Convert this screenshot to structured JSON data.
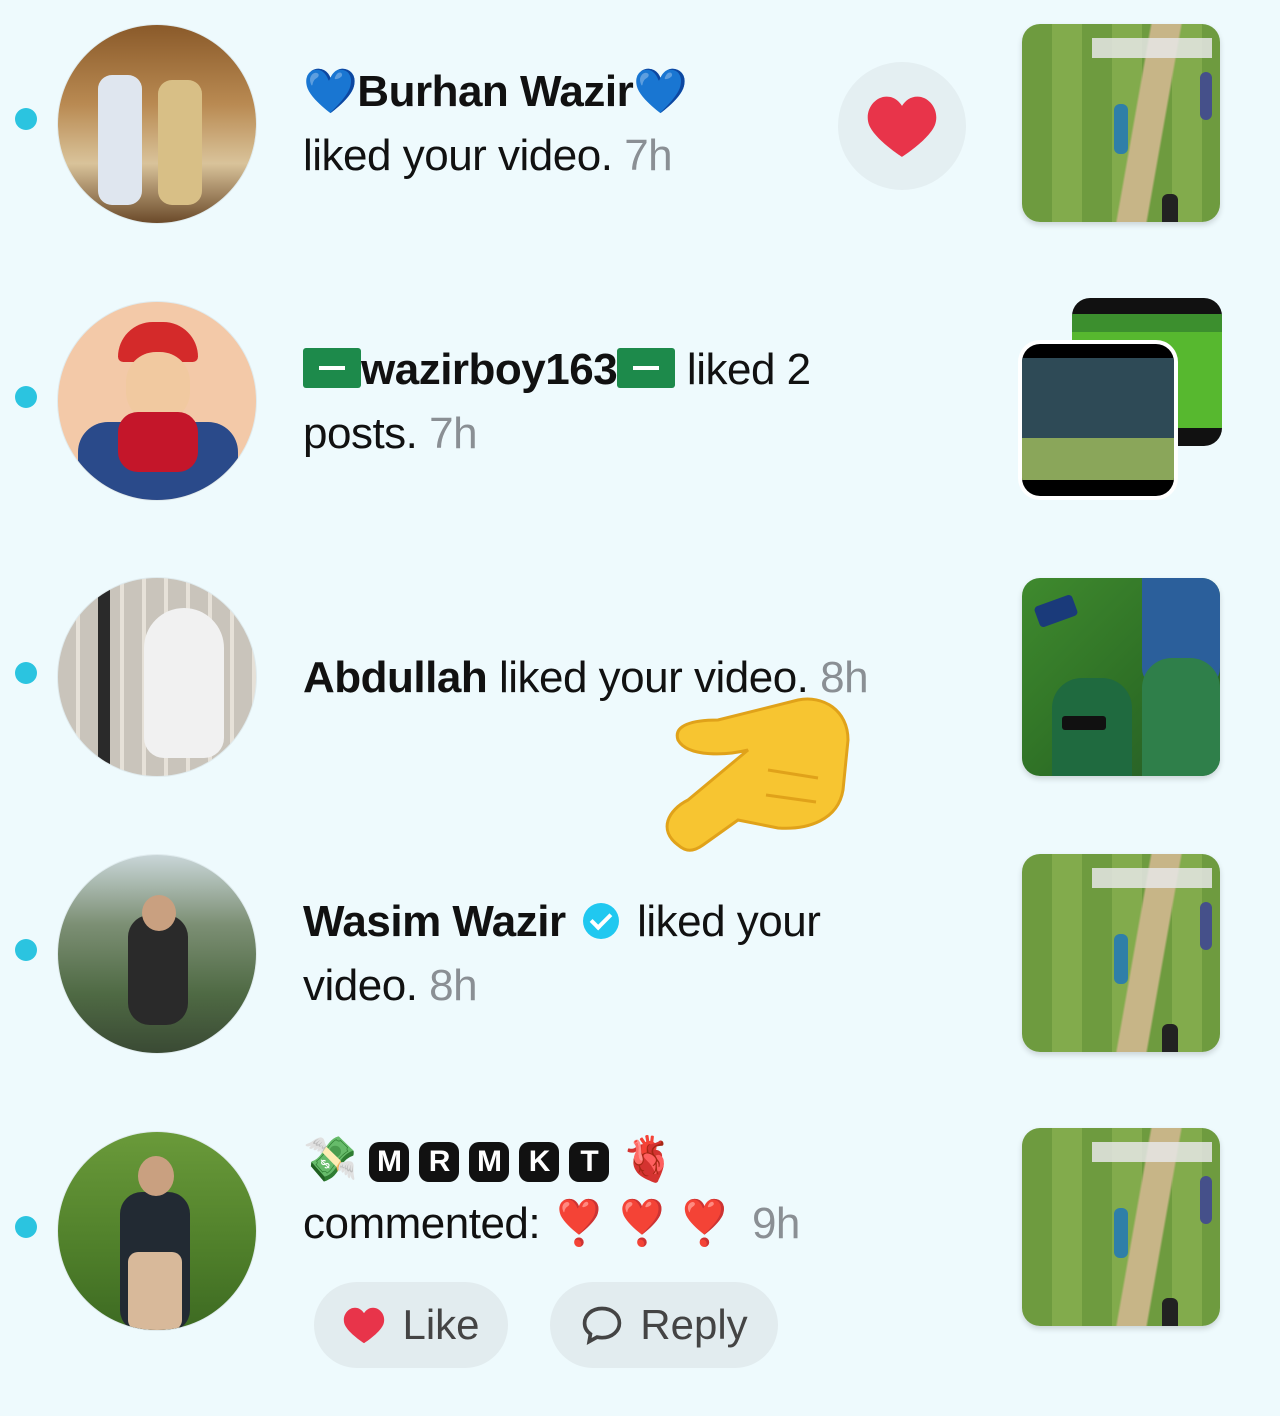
{
  "notifications": [
    {
      "name_prefix": "💙",
      "name": "Burhan Wazir",
      "name_suffix": "💙",
      "action": "liked your video.",
      "time": "7h",
      "heart_button": "❤"
    },
    {
      "name": "wazirboy163",
      "action": "liked 2",
      "action_line2": "posts.",
      "time": "7h"
    },
    {
      "name": "Abdullah",
      "action": "liked your video.",
      "time": "8h"
    },
    {
      "name": "Wasim Wazir",
      "action": "liked your",
      "action_line2": "video.",
      "time": "8h"
    },
    {
      "name_emoji_left": "💸",
      "name_letters": [
        "M",
        "R",
        "M",
        "K",
        "T"
      ],
      "name_emoji_right": "🫀",
      "action": "commented:",
      "comment": "❣️❣️❣️",
      "time": "9h",
      "like_label": "Like",
      "reply_label": "Reply"
    }
  ],
  "overlay": {
    "pointer_emoji": "👉"
  },
  "colors": {
    "background": "#eefafd",
    "unread_dot": "#2bc4e0",
    "like_heart": "#e8344a"
  }
}
